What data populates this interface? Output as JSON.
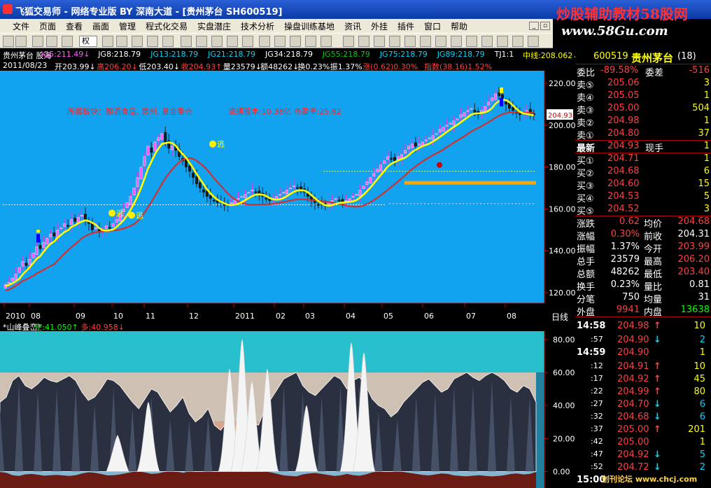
{
  "window": {
    "title": "飞狐交易师 - 网络专业版 BY 深南大道 - [贵州茅台 SH600519]",
    "watermark": "炒股辅助教材58股网",
    "watermark_url": "www.58Gu.com"
  },
  "menu": [
    "文件",
    "页面",
    "查看",
    "画面",
    "管理",
    "程式化交易",
    "实盘潜庄",
    "技术分析",
    "操盘训练基地",
    "资讯",
    "外挂",
    "插件",
    "窗口",
    "帮助"
  ],
  "toolbar": {
    "quan_label": "权"
  },
  "info1": [
    {
      "text": "贵州茅台 股海",
      "color": "#ffffff"
    },
    {
      "text": "JG5:211.49↓",
      "color": "#ff5aff"
    },
    {
      "text": "JG8:218.79",
      "color": "#ffffff"
    },
    {
      "text": "JG13:218.79",
      "color": "#00d8ff"
    },
    {
      "text": "JG21:218.79",
      "color": "#00d8ff"
    },
    {
      "text": "JG34:218.79",
      "color": "#ffffff"
    },
    {
      "text": "JG55:218.79",
      "color": "#00d000"
    },
    {
      "text": "JG75:218.79",
      "color": "#00d8ff"
    },
    {
      "text": "JG89:218.79",
      "color": "#00d8ff"
    },
    {
      "text": "TJ1:1",
      "color": "#ffffff"
    },
    {
      "text": "中线:208.062↓",
      "color": "#ffff00"
    }
  ],
  "info2": [
    {
      "text": "2011/08/23",
      "color": "#ffffff"
    },
    {
      "text": "开203.99↓",
      "color": "#ffffff"
    },
    {
      "text": "高206.20↓",
      "color": "#ff4040"
    },
    {
      "text": "低203.40↓",
      "color": "#ffffff"
    },
    {
      "text": "收204.93↑",
      "color": "#ff4040"
    },
    {
      "text": "量23579↓",
      "color": "#ffffff"
    },
    {
      "text": "额48262↓",
      "color": "#ffffff"
    },
    {
      "text": "换0.23%",
      "color": "#ffffff"
    },
    {
      "text": "振1.37%",
      "color": "#ffffff"
    },
    {
      "text": "涨(0.62)0.30%",
      "color": "#ff4040"
    },
    {
      "text": "指数(38.16)1.52%",
      "color": "#ff4040"
    }
  ],
  "annotations": {
    "sector": "所属板块：酿酒食品, 贵州, 基金重仓",
    "shares": "流通股本:10.38亿  市盈率:25.62",
    "escape": "逃",
    "price_tag": "204.93"
  },
  "chart_data": [
    {
      "type": "candlestick",
      "yticks": [
        120.0,
        140.0,
        160.0,
        180.0,
        200.0,
        220.0
      ],
      "ylim": [
        115,
        226
      ],
      "xticks": [
        "2010",
        "08",
        "09",
        "10",
        "11",
        "12",
        "2011",
        "02",
        "03",
        "04",
        "05",
        "06",
        "07",
        "08"
      ],
      "period_label": "日线",
      "series": [
        {
          "name": "JG5",
          "color": "#ff5aff"
        },
        {
          "name": "中线",
          "color": "#ffff00"
        }
      ],
      "close": [
        124,
        125,
        127,
        129,
        132,
        135,
        133,
        136,
        139,
        142,
        141,
        144,
        146,
        148,
        147,
        150,
        151,
        153,
        152,
        155,
        154,
        156,
        157,
        155,
        153,
        150,
        151,
        149,
        150,
        152,
        151,
        153,
        155,
        158,
        160,
        163,
        166,
        170,
        175,
        180,
        185,
        190,
        187,
        192,
        194,
        196,
        192,
        189,
        190,
        188,
        185,
        183,
        180,
        178,
        175,
        172,
        170,
        168,
        166,
        165,
        164,
        163,
        163,
        162,
        162,
        163,
        164,
        165,
        166,
        167,
        168,
        169,
        168,
        167,
        166,
        165,
        164,
        165,
        166,
        167,
        168,
        169,
        170,
        171,
        170,
        169,
        168,
        166,
        164,
        163,
        162,
        162,
        162,
        163,
        164,
        165,
        164,
        163,
        164,
        165,
        166,
        167,
        169,
        171,
        173,
        175,
        177,
        179,
        181,
        183,
        185,
        184,
        183,
        185,
        186,
        188,
        190,
        191,
        190,
        191,
        192,
        193,
        194,
        195,
        196,
        198,
        199,
        200,
        201,
        202,
        203,
        205,
        206,
        207,
        208,
        206,
        205,
        207,
        209,
        211,
        213,
        215,
        214,
        212,
        210,
        208,
        207,
        206,
        205,
        206,
        207,
        205,
        204.93
      ],
      "colors": {
        "up": "#ff5aff",
        "down": "#1a1a1a",
        "ma_fast": "#ffff00",
        "ma_slow": "#d03030"
      }
    },
    {
      "type": "area",
      "name": "山峰叠峦",
      "yticks": [
        0.0,
        20.0,
        40.0,
        60.0,
        80.0
      ],
      "ylim": [
        -10,
        85
      ],
      "legend": [
        {
          "label": "*山峰叠峦*",
          "color": "#ffffff"
        },
        {
          "label": "空:41.050↑",
          "color": "#00ff00"
        },
        {
          "label": "多:40.958↓",
          "color": "#ff4040"
        }
      ],
      "dark_peaks": [
        42,
        45,
        55,
        58,
        52,
        50,
        53,
        57,
        55,
        54,
        56,
        58,
        55,
        48,
        43,
        45,
        50,
        56,
        55,
        52,
        47,
        42,
        38,
        44,
        50,
        48,
        42,
        36,
        40,
        45,
        35,
        30,
        33,
        38,
        28,
        25,
        30,
        22,
        26,
        24,
        30,
        28,
        38,
        44,
        50,
        56,
        58,
        60,
        52,
        48,
        46,
        50,
        54,
        58,
        56,
        50,
        55,
        57,
        52,
        44,
        40,
        38,
        33,
        36,
        42,
        46,
        50,
        54,
        56,
        52,
        48,
        50,
        56,
        58,
        60,
        57,
        55,
        58,
        60,
        58,
        55,
        50,
        48,
        52,
        50,
        42
      ],
      "white_peaks": [
        {
          "x": 168,
          "h": 22
        },
        {
          "x": 212,
          "h": 42
        },
        {
          "x": 328,
          "h": 62
        },
        {
          "x": 346,
          "h": 80
        },
        {
          "x": 360,
          "h": 55
        },
        {
          "x": 382,
          "h": 62
        },
        {
          "x": 438,
          "h": 40
        },
        {
          "x": 502,
          "h": 78
        },
        {
          "x": 520,
          "h": 72
        }
      ]
    }
  ],
  "quote": {
    "code": "600519",
    "name": "贵州茅台",
    "badge": "(18)",
    "wb_label": "委比",
    "wb_value": "-89.58%",
    "wc_label": "委差",
    "wc_value": "-516",
    "asks": [
      {
        "label": "卖⑤",
        "price": "205.06",
        "vol": "3"
      },
      {
        "label": "卖④",
        "price": "205.05",
        "vol": "1"
      },
      {
        "label": "卖③",
        "price": "205.00",
        "vol": "504"
      },
      {
        "label": "卖②",
        "price": "204.98",
        "vol": "1"
      },
      {
        "label": "卖①",
        "price": "204.80",
        "vol": "37"
      }
    ],
    "latest_label": "最新",
    "latest": "204.93",
    "hand_label": "现手",
    "hand": "1",
    "bids": [
      {
        "label": "买①",
        "price": "204.71",
        "vol": "1"
      },
      {
        "label": "买②",
        "price": "204.68",
        "vol": "6"
      },
      {
        "label": "买③",
        "price": "204.60",
        "vol": "15"
      },
      {
        "label": "买④",
        "price": "204.53",
        "vol": "5"
      },
      {
        "label": "买⑤",
        "price": "204.52",
        "vol": "3"
      }
    ],
    "stats": [
      {
        "l1": "涨跌",
        "v1": "0.62",
        "l2": "均价",
        "v2": "204.68"
      },
      {
        "l1": "涨幅",
        "v1": "0.30%",
        "l2": "前收",
        "v2": "204.31"
      },
      {
        "l1": "振幅",
        "v1": "1.37%",
        "l2": "今开",
        "v2": "203.99"
      },
      {
        "l1": "总手",
        "v1": "23579",
        "l2": "最高",
        "v2": "206.20"
      },
      {
        "l1": "总额",
        "v1": "48262",
        "l2": "最低",
        "v2": "203.40"
      },
      {
        "l1": "换手",
        "v1": "0.23%",
        "l2": "量比",
        "v2": "0.81"
      },
      {
        "l1": "分笔",
        "v1": "750",
        "l2": "均量",
        "v2": "31"
      }
    ],
    "outer_label": "外盘",
    "outer": "9941",
    "inner_label": "内盘",
    "inner": "13638",
    "ticks": [
      {
        "t": "14:58",
        "p": "204.98",
        "d": "up",
        "v": "10"
      },
      {
        "t": ":57",
        "p": "204.90",
        "d": "down",
        "v": "2"
      },
      {
        "t": "14:59",
        "p": "204.90",
        "d": "",
        "v": "1"
      },
      {
        "t": ":12",
        "p": "204.91",
        "d": "up",
        "v": "10"
      },
      {
        "t": ":17",
        "p": "204.92",
        "d": "up",
        "v": "45"
      },
      {
        "t": ":22",
        "p": "204.99",
        "d": "up",
        "v": "80"
      },
      {
        "t": ":27",
        "p": "204.70",
        "d": "down",
        "v": "6"
      },
      {
        "t": ":32",
        "p": "204.68",
        "d": "down",
        "v": "6"
      },
      {
        "t": ":37",
        "p": "205.00",
        "d": "up",
        "v": "201"
      },
      {
        "t": ":42",
        "p": "205.00",
        "d": "",
        "v": "1"
      },
      {
        "t": ":47",
        "p": "204.92",
        "d": "down",
        "v": "5"
      },
      {
        "t": ":52",
        "p": "204.72",
        "d": "down",
        "v": "2"
      },
      {
        "t": "15:00",
        "p": "",
        "d": "",
        "v": ""
      }
    ]
  },
  "footer": "创刊论坛 www.chcj.com"
}
